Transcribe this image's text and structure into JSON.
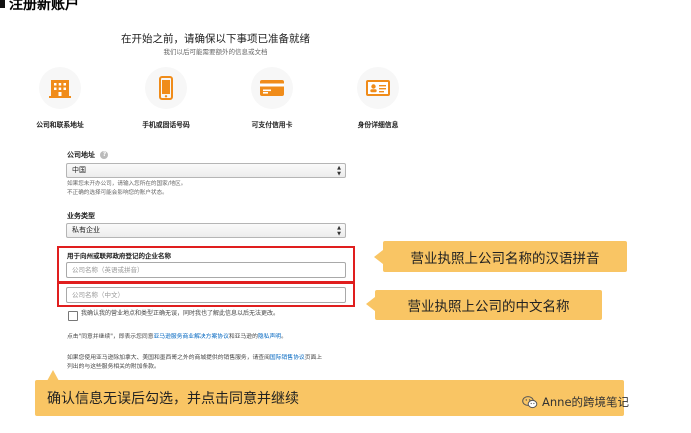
{
  "page": {
    "title_fragment": "注册新账户"
  },
  "intro": {
    "heading": "在开始之前，请确保以下事项已准备就绪",
    "subheading": "我们以后可能需要额外的信息或文档"
  },
  "steps": [
    {
      "icon": "building-icon",
      "label": "公司和联系地址"
    },
    {
      "icon": "mobile-phone-icon",
      "label": "手机或固话号码"
    },
    {
      "icon": "credit-card-icon",
      "label": "可支付信用卡"
    },
    {
      "icon": "id-card-icon",
      "label": "身份详细信息"
    }
  ],
  "form": {
    "country_label": "公司地址",
    "country_value": "中国",
    "country_hint_1": "如果您未开办公司，请输入您所在的国家/地区。",
    "country_hint_2": "不正确的选择可能会影响您的账户状态。",
    "business_type_label": "业务类型",
    "business_type_value": "私有企业",
    "company_name_label": "用于向州或联邦政府登记的企业名称",
    "company_name_en_placeholder": "公司名称（英语或拼音）",
    "company_name_cn_placeholder": "公司名称（中文）",
    "confirm_checkbox_label": "我确认我的营业地点和类型正确无误，同时我也了解此信息以后无法更改。",
    "agreement_prefix": "点击\"同意并继续\"，即表示您同意",
    "agreement_link_1": "亚马逊服务商业解决方案协议",
    "agreement_mid": "和亚马逊的",
    "agreement_link_2": "隐私声明",
    "agreement_suffix": "。",
    "foreign_prefix": "如果您使用亚马逊除加拿大、美国和墨西哥之外的商城提供的销售服务，请查阅",
    "foreign_link": "国际销售协议",
    "foreign_suffix": "页面上",
    "foreign_line2": "列出的与这些服务相关的附加条款。"
  },
  "annotations": {
    "pinyin_callout": "营业执照上公司名称的汉语拼音",
    "chinese_callout": "营业执照上公司的中文名称",
    "confirm_callout": "确认信息无误后勾选，并点击同意并继续"
  },
  "watermark": {
    "text": "Anne的跨境笔记"
  },
  "colors": {
    "accent_orange": "#f08c1a",
    "highlight_red": "#e01e1e",
    "callout_fill": "#f9c564",
    "link_blue": "#0066c0"
  }
}
